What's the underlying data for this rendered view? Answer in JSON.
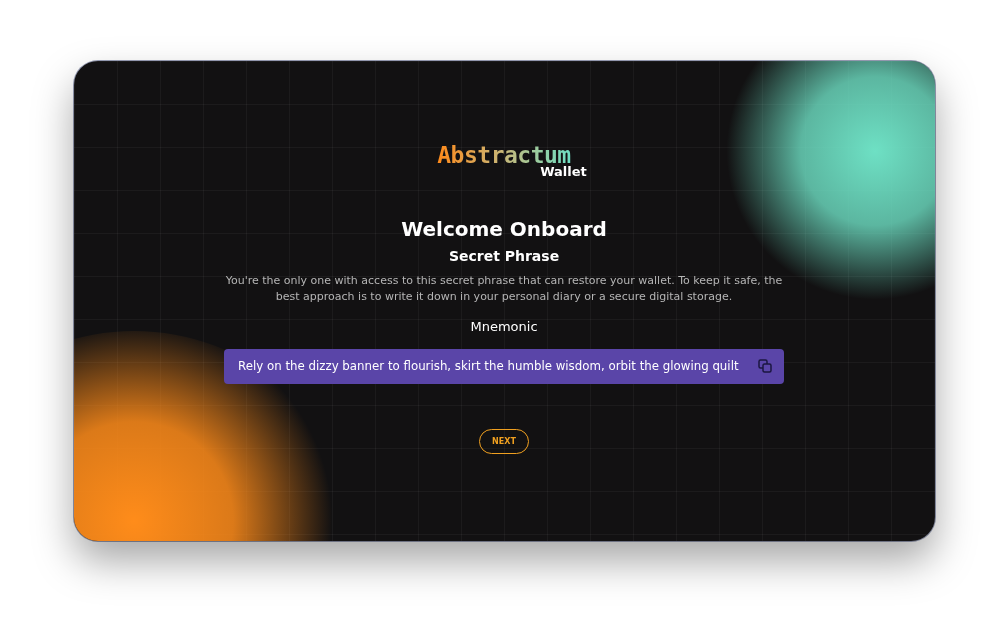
{
  "logo": {
    "name": "Abstractum",
    "subtitle": "Wallet"
  },
  "title": "Welcome Onboard",
  "subtitle": "Secret Phrase",
  "description": "You're the only one with access to this secret phrase that can restore your wallet. To keep it safe, the best approach is to write it down in your personal diary or a secure digital storage.",
  "mnemonic": {
    "label": "Mnemonic",
    "phrase": "Rely on the dizzy banner to flourish, skirt the humble wisdom, orbit the glowing quilt"
  },
  "buttons": [
    "NEXT"
  ]
}
